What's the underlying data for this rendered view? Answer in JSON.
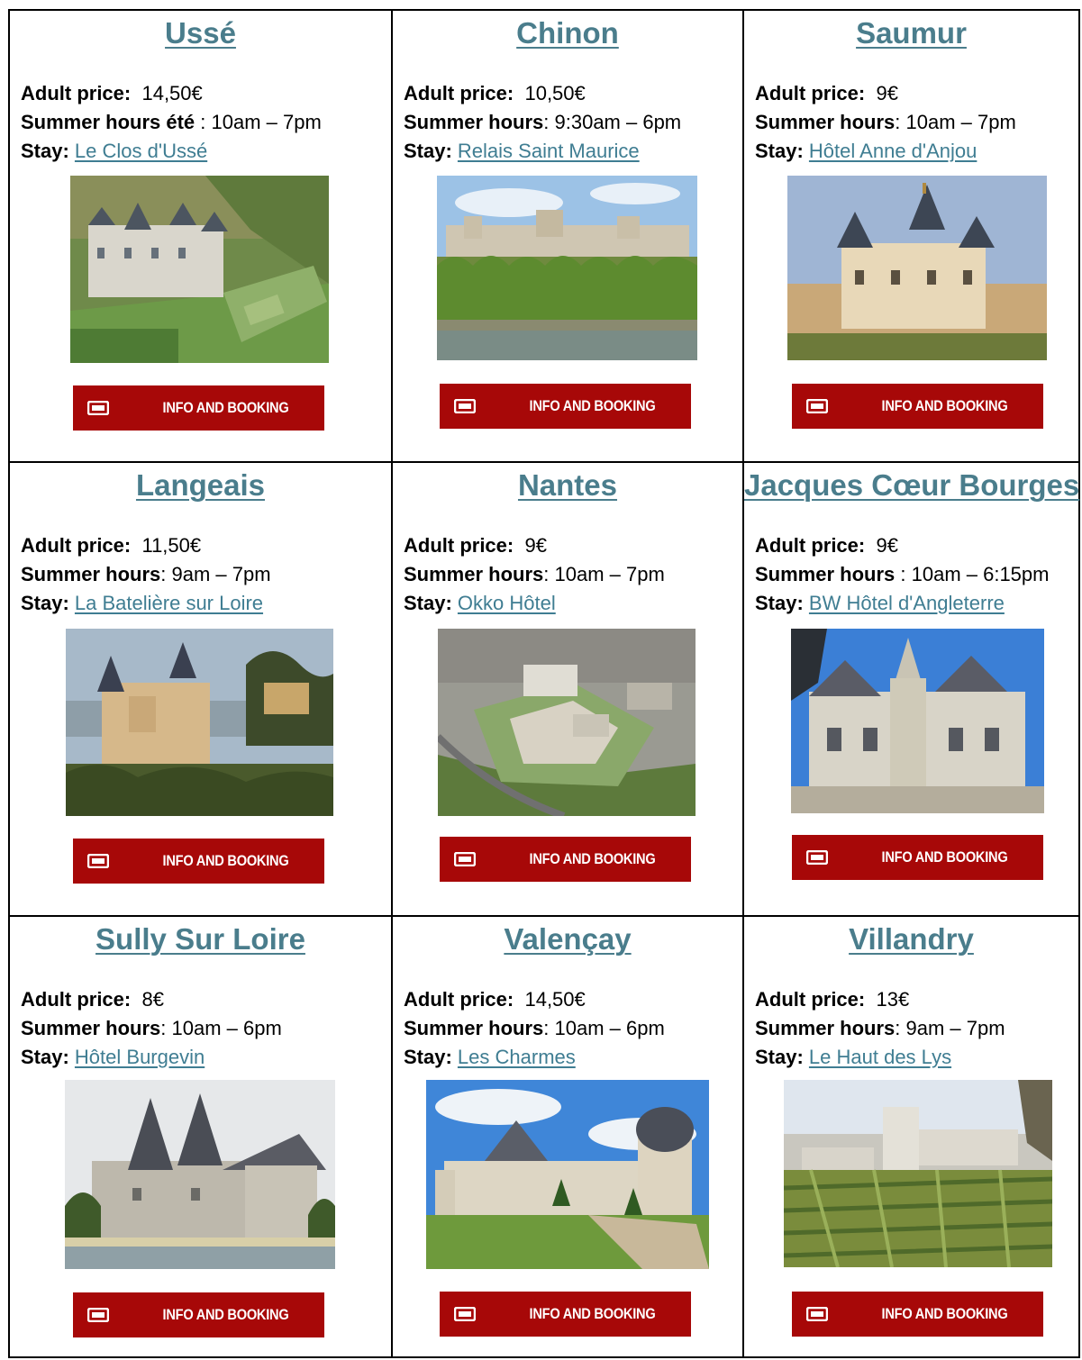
{
  "labels": {
    "price": "Adult price:",
    "stay": "Stay:"
  },
  "button_label": "INFO AND BOOKING",
  "colors": {
    "title": "#4a7d8c",
    "link": "#3f7d92",
    "button": "#a70808"
  },
  "castles": [
    {
      "name": "Ussé",
      "price": "14,50€",
      "hours_label": "Summer hours été",
      "hours_sep": " : ",
      "hours": "10am – 7pm",
      "stay": "Le Clos d'Ussé",
      "photo": "castle-usse-photo"
    },
    {
      "name": "Chinon",
      "price": "10,50€",
      "hours_label": "Summer hours",
      "hours_sep": ": ",
      "hours": "9:30am – 6pm",
      "stay": "Relais Saint Maurice",
      "photo": "castle-chinon-photo"
    },
    {
      "name": "Saumur",
      "price": "9€",
      "hours_label": "Summer hours",
      "hours_sep": ": ",
      "hours": "10am – 7pm",
      "stay": "Hôtel Anne d'Anjou",
      "photo": "castle-saumur-photo"
    },
    {
      "name": "Langeais",
      "price": "11,50€",
      "hours_label": "Summer hours",
      "hours_sep": ": ",
      "hours": "9am – 7pm",
      "stay": "La Batelière sur Loire",
      "photo": "castle-langeais-photo"
    },
    {
      "name": "Nantes",
      "price": "9€",
      "hours_label": "Summer hours",
      "hours_sep": ": ",
      "hours": "10am – 7pm",
      "stay": "Okko Hôtel",
      "photo": "castle-nantes-photo"
    },
    {
      "name": "Jacques Cœur Bourges",
      "price": "9€",
      "hours_label": "Summer hours",
      "hours_sep": " : ",
      "hours": "10am – 6:15pm",
      "stay": "BW Hôtel d'Angleterre",
      "photo": "palace-bourges-photo"
    },
    {
      "name": "Sully Sur Loire",
      "price": "8€",
      "hours_label": "Summer hours",
      "hours_sep": ": ",
      "hours": "10am – 6pm",
      "stay": "Hôtel Burgevin",
      "photo": "castle-sully-photo"
    },
    {
      "name": "Valençay",
      "price": "14,50€",
      "hours_label": "Summer hours",
      "hours_sep": ": ",
      "hours": "10am – 6pm",
      "stay": "Les Charmes",
      "photo": "castle-valencay-photo"
    },
    {
      "name": "Villandry",
      "price": "13€",
      "hours_label": "Summer hours",
      "hours_sep": ": ",
      "hours": "9am – 7pm",
      "stay": "Le Haut des Lys",
      "photo": "castle-villandry-photo"
    }
  ]
}
